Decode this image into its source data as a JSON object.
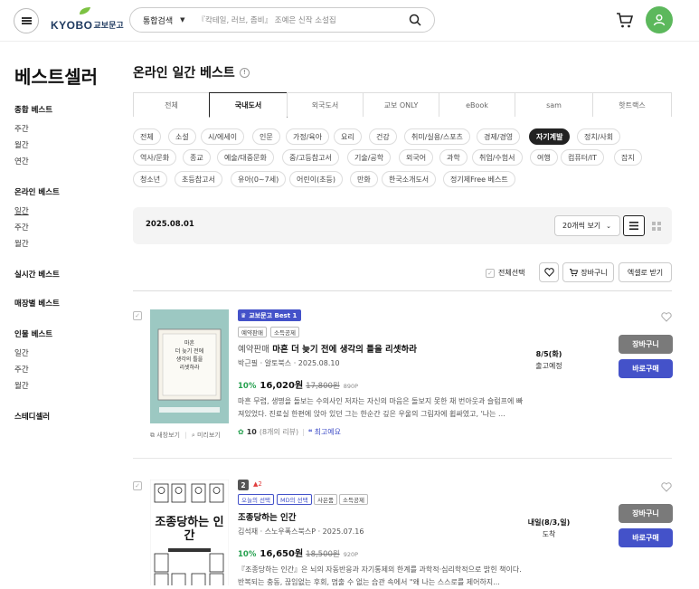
{
  "header": {
    "logo_en": "KYOBO",
    "logo_ko": "교보문고",
    "search_category": "통합검색",
    "search_placeholder": "『칵테일, 러브, 좀비』 조예은 신작 소설집"
  },
  "sidebar": {
    "title": "베스트셀러",
    "groups": [
      {
        "title": "종합 베스트",
        "items": [
          "주간",
          "월간",
          "연간"
        ]
      },
      {
        "title": "온라인 베스트",
        "items": [
          "일간",
          "주간",
          "월간"
        ]
      },
      {
        "title": "실시간 베스트",
        "items": []
      },
      {
        "title": "매장별 베스트",
        "items": []
      },
      {
        "title": "인물 베스트",
        "items": [
          "일간",
          "주간",
          "월간"
        ]
      },
      {
        "title": "스테디셀러",
        "items": []
      }
    ]
  },
  "main": {
    "title": "온라인 일간 베스트",
    "info_glyph": "!",
    "tabs": [
      "전체",
      "국내도서",
      "외국도서",
      "교보 ONLY",
      "eBook",
      "sam",
      "핫트랙스"
    ],
    "active_tab": "국내도서",
    "categories": [
      [
        "전체",
        "소설",
        "시/에세이",
        "인문",
        "가정/육아",
        "요리",
        "건강",
        "취미/실용/스포츠",
        "경제/경영",
        "자기계발",
        "정치/사회"
      ],
      [
        "역사/문화",
        "종교",
        "예술/대중문화",
        "중/고등참고서",
        "기술/공학",
        "외국어",
        "과학",
        "취업/수험서",
        "여행",
        "컴퓨터/IT",
        "잡지"
      ],
      [
        "청소년",
        "초등참고서",
        "유아(0~7세)",
        "어린이(초등)",
        "만화",
        "한국소개도서",
        "정기제Free 베스트"
      ]
    ],
    "active_category": "자기계발",
    "date": "2025.08.01",
    "per_page": "20개씩 보기",
    "select_all": "전체선택",
    "cart_all": "장바구니",
    "excel": "엑셀로 받기"
  },
  "products": [
    {
      "badge": "교보문고 Best 1",
      "tags": [
        "예약판매",
        "소득공제"
      ],
      "title_prefix": "예약판매",
      "title": "마흔 더 늦기 전에 생각의 틀을 리셋하라",
      "meta": "박근필 · 알토북스 · 2025.08.10",
      "discount": "10%",
      "price": "16,020원",
      "original_price": "17,800원",
      "points": "890P",
      "desc": "마흔 무렵, 생명을 돌보는 수의사인 저자는 자신의 마음은 돌보지 못한 채 번아웃과 슬럼프에 빠져있었다. 진료실 한편에 앉아 있던 그는 한순간 깊은 우울의 그림자에 휩싸였고, '나는 ...",
      "rating": "10",
      "review_count": "(8개의 리뷰)",
      "review_keyword": "최고예요",
      "delivery_date": "8/5(화)",
      "delivery_note": "출고예정",
      "cover_lines": [
        "마흔",
        "더 늦기 전에",
        "생각의 틀을",
        "리셋하라"
      ],
      "preview": "새창보기",
      "look_inside": "미리보기",
      "cart_label": "장바구니",
      "buy_label": "바로구매"
    },
    {
      "rank": "2",
      "rank_change": "▲2",
      "tags": [
        "오늘의 선택",
        "MD의 선택",
        "사은품",
        "소득공제"
      ],
      "title": "조종당하는 인간",
      "meta": "김석재 · 스노우폭스북스P · 2025.07.16",
      "discount": "10%",
      "price": "16,650원",
      "original_price": "18,500원",
      "points": "920P",
      "desc": "『조종당하는 인간』은 뇌의 자동반응과 자기통제의 한계를 과학적·심리학적으로 밝힌 책이다. 반복되는 충동, 끊임없는 후회, 멈출 수 없는 습관 속에서 \"왜 나는 스스로를 제어하지...",
      "delivery_date": "내일(8/3,일)",
      "delivery_note": "도착",
      "cover_title": "조종당하는 인간",
      "cart_label": "장바구니",
      "buy_label": "바로구매"
    }
  ],
  "colors": {
    "accent_green": "#5cb85c",
    "buy_blue": "#4452c9",
    "cart_gray": "#7a7a7a",
    "discount_green": "#27a150"
  }
}
